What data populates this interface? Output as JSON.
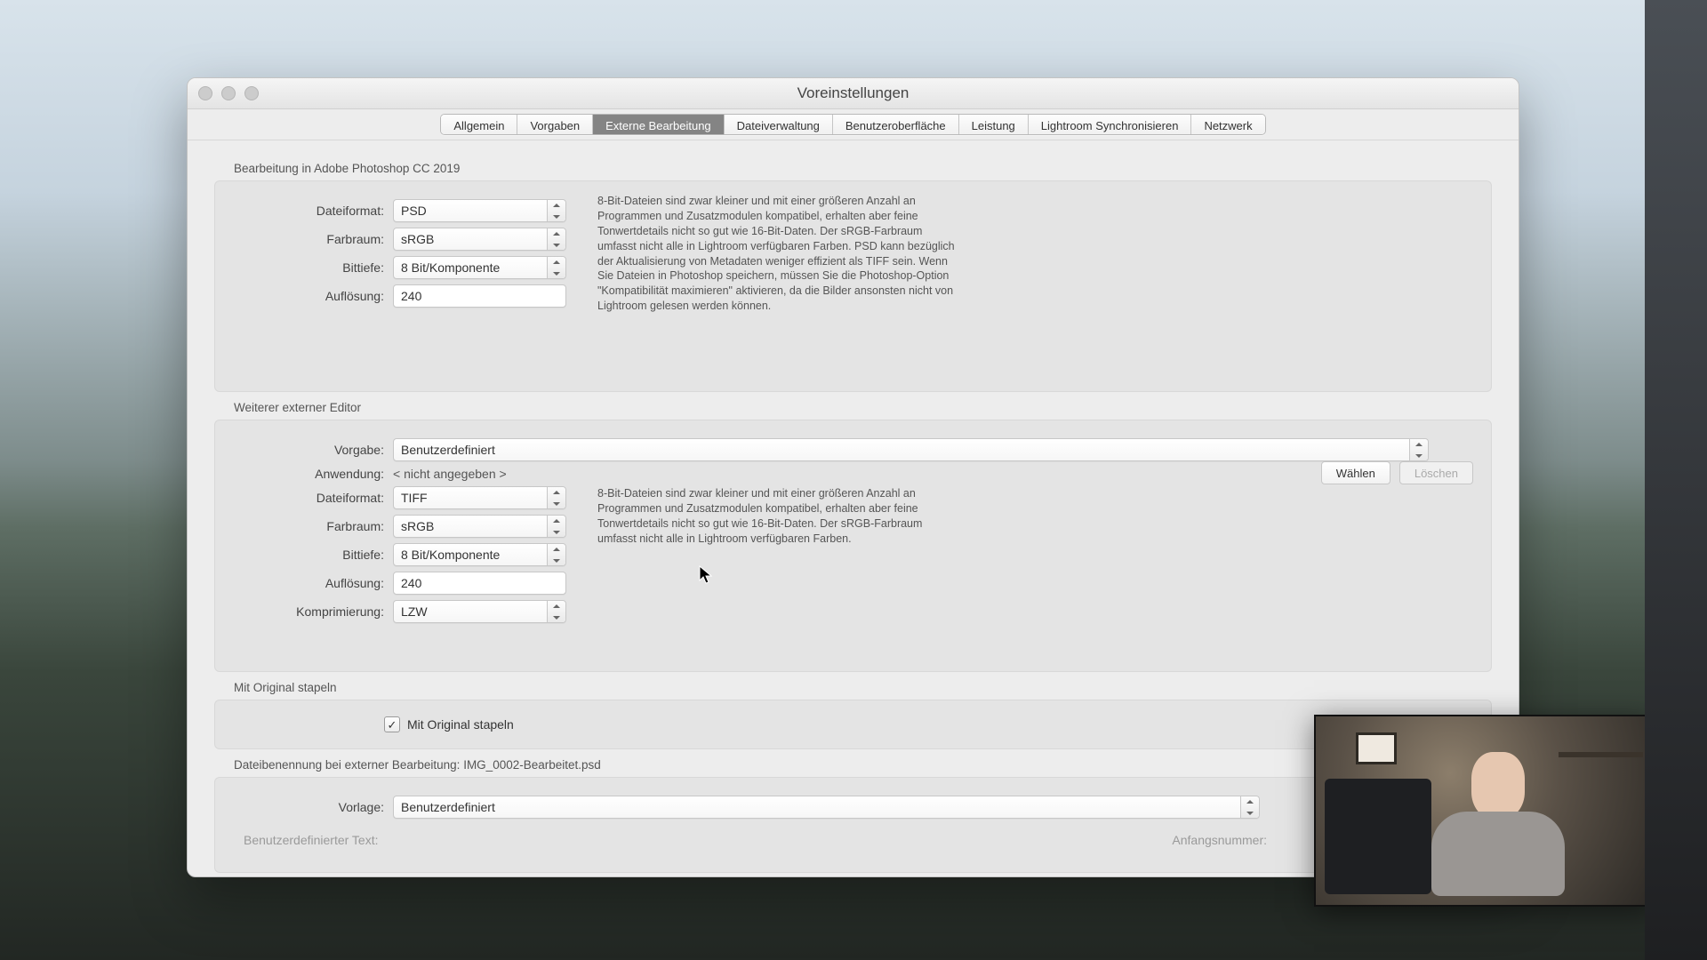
{
  "window": {
    "title": "Voreinstellungen"
  },
  "tabs": {
    "allgemein": "Allgemein",
    "vorgaben": "Vorgaben",
    "externe": "Externe Bearbeitung",
    "dateiverwaltung": "Dateiverwaltung",
    "benutzeroberflaeche": "Benutzeroberfläche",
    "leistung": "Leistung",
    "lightroom_sync": "Lightroom Synchronisieren",
    "netzwerk": "Netzwerk"
  },
  "section1": {
    "heading": "Bearbeitung in Adobe Photoshop CC 2019",
    "dateiformat_label": "Dateiformat:",
    "dateiformat_value": "PSD",
    "farbraum_label": "Farbraum:",
    "farbraum_value": "sRGB",
    "bittiefe_label": "Bittiefe:",
    "bittiefe_value": "8 Bit/Komponente",
    "aufloesung_label": "Auflösung:",
    "aufloesung_value": "240",
    "hint": "8-Bit-Dateien sind zwar kleiner und mit einer größeren Anzahl an Programmen und Zusatzmodulen kompatibel, erhalten aber feine Tonwertdetails nicht so gut wie 16-Bit-Daten. Der sRGB-Farbraum umfasst nicht alle in Lightroom verfügbaren Farben. PSD kann bezüglich der Aktualisierung von Metadaten weniger effizient als TIFF sein. Wenn Sie Dateien in Photoshop speichern, müssen Sie die Photoshop-Option \"Kompatibilität maximieren\" aktivieren, da die Bilder ansonsten nicht von Lightroom gelesen werden können."
  },
  "section2": {
    "heading": "Weiterer externer Editor",
    "vorgabe_label": "Vorgabe:",
    "vorgabe_value": "Benutzerdefiniert",
    "anwendung_label": "Anwendung:",
    "anwendung_value": "< nicht angegeben >",
    "waehlen": "Wählen",
    "loeschen": "Löschen",
    "dateiformat_label": "Dateiformat:",
    "dateiformat_value": "TIFF",
    "farbraum_label": "Farbraum:",
    "farbraum_value": "sRGB",
    "bittiefe_label": "Bittiefe:",
    "bittiefe_value": "8 Bit/Komponente",
    "aufloesung_label": "Auflösung:",
    "aufloesung_value": "240",
    "komprimierung_label": "Komprimierung:",
    "komprimierung_value": "LZW",
    "hint": "8-Bit-Dateien sind zwar kleiner und mit einer größeren Anzahl an Programmen und Zusatzmodulen kompatibel, erhalten aber feine Tonwertdetails nicht so gut wie 16-Bit-Daten. Der sRGB-Farbraum umfasst nicht alle in Lightroom verfügbaren Farben."
  },
  "section3": {
    "heading": "Mit Original stapeln",
    "checkbox_label": "Mit Original stapeln",
    "checked": true
  },
  "section4": {
    "heading": "Dateibenennung bei externer Bearbeitung: IMG_0002-Bearbeitet.psd",
    "vorlage_label": "Vorlage:",
    "vorlage_value": "Benutzerdefiniert",
    "custom_text_label": "Benutzerdefinierter Text:",
    "start_number_label": "Anfangsnummer:"
  }
}
